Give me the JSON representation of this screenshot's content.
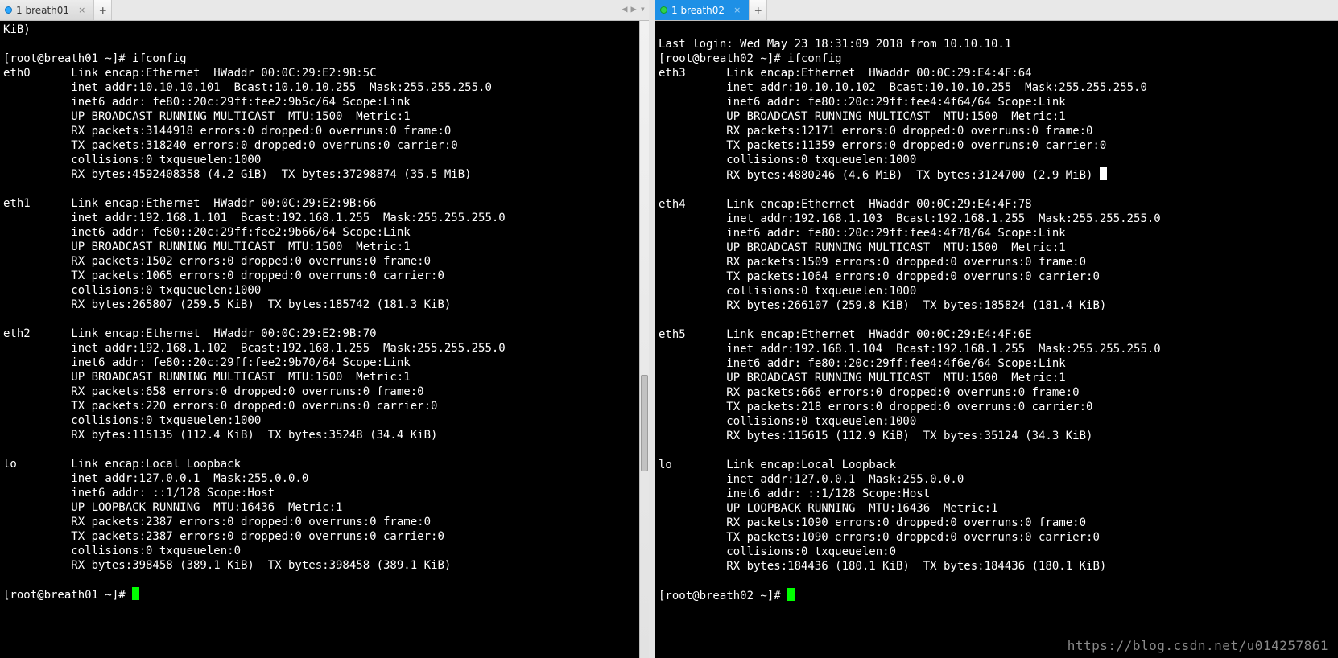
{
  "left": {
    "tab": {
      "label": "1 breath01",
      "dot": "blue",
      "active": false
    },
    "lines": [
      "KiB)",
      "",
      "[root@breath01 ~]# ifconfig",
      "eth0      Link encap:Ethernet  HWaddr 00:0C:29:E2:9B:5C",
      "          inet addr:10.10.10.101  Bcast:10.10.10.255  Mask:255.255.255.0",
      "          inet6 addr: fe80::20c:29ff:fee2:9b5c/64 Scope:Link",
      "          UP BROADCAST RUNNING MULTICAST  MTU:1500  Metric:1",
      "          RX packets:3144918 errors:0 dropped:0 overruns:0 frame:0",
      "          TX packets:318240 errors:0 dropped:0 overruns:0 carrier:0",
      "          collisions:0 txqueuelen:1000",
      "          RX bytes:4592408358 (4.2 GiB)  TX bytes:37298874 (35.5 MiB)",
      "",
      "eth1      Link encap:Ethernet  HWaddr 00:0C:29:E2:9B:66",
      "          inet addr:192.168.1.101  Bcast:192.168.1.255  Mask:255.255.255.0",
      "          inet6 addr: fe80::20c:29ff:fee2:9b66/64 Scope:Link",
      "          UP BROADCAST RUNNING MULTICAST  MTU:1500  Metric:1",
      "          RX packets:1502 errors:0 dropped:0 overruns:0 frame:0",
      "          TX packets:1065 errors:0 dropped:0 overruns:0 carrier:0",
      "          collisions:0 txqueuelen:1000",
      "          RX bytes:265807 (259.5 KiB)  TX bytes:185742 (181.3 KiB)",
      "",
      "eth2      Link encap:Ethernet  HWaddr 00:0C:29:E2:9B:70",
      "          inet addr:192.168.1.102  Bcast:192.168.1.255  Mask:255.255.255.0",
      "          inet6 addr: fe80::20c:29ff:fee2:9b70/64 Scope:Link",
      "          UP BROADCAST RUNNING MULTICAST  MTU:1500  Metric:1",
      "          RX packets:658 errors:0 dropped:0 overruns:0 frame:0",
      "          TX packets:220 errors:0 dropped:0 overruns:0 carrier:0",
      "          collisions:0 txqueuelen:1000",
      "          RX bytes:115135 (112.4 KiB)  TX bytes:35248 (34.4 KiB)",
      "",
      "lo        Link encap:Local Loopback",
      "          inet addr:127.0.0.1  Mask:255.0.0.0",
      "          inet6 addr: ::1/128 Scope:Host",
      "          UP LOOPBACK RUNNING  MTU:16436  Metric:1",
      "          RX packets:2387 errors:0 dropped:0 overruns:0 frame:0",
      "          TX packets:2387 errors:0 dropped:0 overruns:0 carrier:0",
      "          collisions:0 txqueuelen:0",
      "          RX bytes:398458 (389.1 KiB)  TX bytes:398458 (389.1 KiB)",
      "",
      "[root@breath01 ~]# "
    ]
  },
  "right": {
    "tab": {
      "label": "1 breath02",
      "dot": "green",
      "active": true
    },
    "lines": [
      "",
      "Last login: Wed May 23 18:31:09 2018 from 10.10.10.1",
      "[root@breath02 ~]# ifconfig",
      "eth3      Link encap:Ethernet  HWaddr 00:0C:29:E4:4F:64",
      "          inet addr:10.10.10.102  Bcast:10.10.10.255  Mask:255.255.255.0",
      "          inet6 addr: fe80::20c:29ff:fee4:4f64/64 Scope:Link",
      "          UP BROADCAST RUNNING MULTICAST  MTU:1500  Metric:1",
      "          RX packets:12171 errors:0 dropped:0 overruns:0 frame:0",
      "          TX packets:11359 errors:0 dropped:0 overruns:0 carrier:0",
      "          collisions:0 txqueuelen:1000",
      "          RX bytes:4880246 (4.6 MiB)  TX bytes:3124700 (2.9 MiB)",
      "",
      "eth4      Link encap:Ethernet  HWaddr 00:0C:29:E4:4F:78",
      "          inet addr:192.168.1.103  Bcast:192.168.1.255  Mask:255.255.255.0",
      "          inet6 addr: fe80::20c:29ff:fee4:4f78/64 Scope:Link",
      "          UP BROADCAST RUNNING MULTICAST  MTU:1500  Metric:1",
      "          RX packets:1509 errors:0 dropped:0 overruns:0 frame:0",
      "          TX packets:1064 errors:0 dropped:0 overruns:0 carrier:0",
      "          collisions:0 txqueuelen:1000",
      "          RX bytes:266107 (259.8 KiB)  TX bytes:185824 (181.4 KiB)",
      "",
      "eth5      Link encap:Ethernet  HWaddr 00:0C:29:E4:4F:6E",
      "          inet addr:192.168.1.104  Bcast:192.168.1.255  Mask:255.255.255.0",
      "          inet6 addr: fe80::20c:29ff:fee4:4f6e/64 Scope:Link",
      "          UP BROADCAST RUNNING MULTICAST  MTU:1500  Metric:1",
      "          RX packets:666 errors:0 dropped:0 overruns:0 frame:0",
      "          TX packets:218 errors:0 dropped:0 overruns:0 carrier:0",
      "          collisions:0 txqueuelen:1000",
      "          RX bytes:115615 (112.9 KiB)  TX bytes:35124 (34.3 KiB)",
      "",
      "lo        Link encap:Local Loopback",
      "          inet addr:127.0.0.1  Mask:255.0.0.0",
      "          inet6 addr: ::1/128 Scope:Host",
      "          UP LOOPBACK RUNNING  MTU:16436  Metric:1",
      "          RX packets:1090 errors:0 dropped:0 overruns:0 frame:0",
      "          TX packets:1090 errors:0 dropped:0 overruns:0 carrier:0",
      "          collisions:0 txqueuelen:0",
      "          RX bytes:184436 (180.1 KiB)  TX bytes:184436 (180.1 KiB)",
      "",
      "[root@breath02 ~]# "
    ]
  },
  "watermark": "https://blog.csdn.net/u014257861",
  "glyphs": {
    "close": "×",
    "add": "+",
    "left": "◀",
    "right": "▶",
    "down": "▾"
  }
}
